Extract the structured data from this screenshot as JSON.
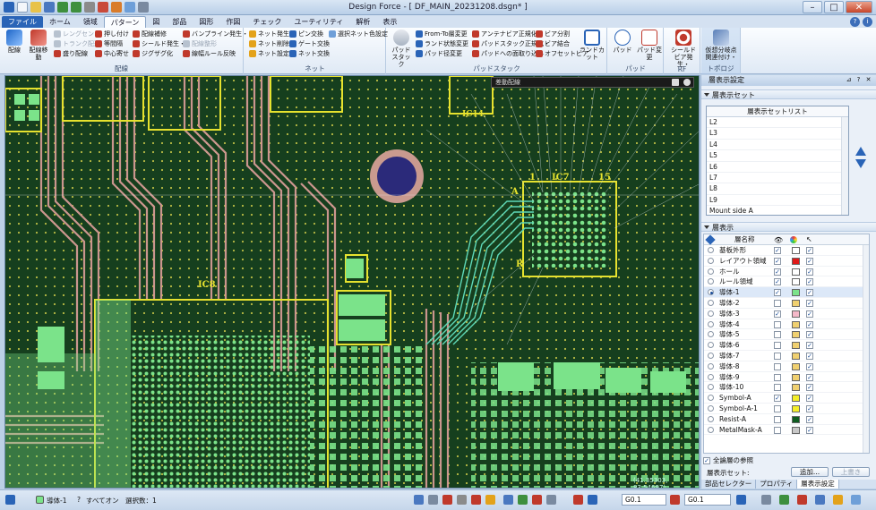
{
  "window": {
    "title": "Design Force - [ DF_MAIN_20231208.dsgn* ]"
  },
  "tabs": [
    {
      "label": "ファイル"
    },
    {
      "label": "ホーム"
    },
    {
      "label": "領域"
    },
    {
      "label": "パターン"
    },
    {
      "label": "図"
    },
    {
      "label": "部品"
    },
    {
      "label": "図形"
    },
    {
      "label": "作図"
    },
    {
      "label": "チェック"
    },
    {
      "label": "ユーティリティ"
    },
    {
      "label": "解析"
    },
    {
      "label": "表示"
    }
  ],
  "ribbon": {
    "wiring": {
      "label": "配線",
      "big": [
        "配線",
        "配線移動"
      ],
      "col1": [
        "レングセン",
        "トランク配形",
        "盛り配線"
      ],
      "col2": [
        "押し付け",
        "等間隔",
        "中心寄せ"
      ],
      "col3": [
        "配線補修",
        "シールド発生・",
        "ジグザグ化"
      ],
      "col4": [
        "バンプライン発生・",
        "配線整形",
        "線幅ルール反映"
      ]
    },
    "net": {
      "label": "ネット",
      "col1": [
        "ネット発生",
        "ネット削除",
        "ネット設定"
      ],
      "col2": [
        "ピン交換",
        "ゲート交換",
        "ネット交換"
      ],
      "col3": [
        "選択ネット色設定"
      ]
    },
    "padstack": {
      "label": "パッドスタック",
      "big": [
        "パッドスタック"
      ],
      "col1": [
        "From-To層変更",
        "ランド状態変更",
        "パッド径変更"
      ],
      "col2": [
        "アンテナビア正規化",
        "パッドスタック正規化・",
        "パッドへの面取り込み"
      ],
      "col3": [
        "ビア分割",
        "ビア結合",
        "オフセットビア"
      ],
      "big2": [
        "ランドカット"
      ]
    },
    "pad": {
      "label": "パッド",
      "big": [
        "パッド",
        "パッド変更"
      ]
    },
    "rf": {
      "label": "RF",
      "big": [
        "シールドビア発生・"
      ]
    },
    "topology": {
      "label": "トポロジ",
      "big": [
        "仮想分岐点関連付け・"
      ]
    }
  },
  "canvas": {
    "float_panel_title": "差動配線",
    "coordinates": "(41.35303, 83.54697)",
    "labels": [
      "IC14",
      "IC7",
      "15",
      "A",
      "1",
      "R",
      "IC8"
    ]
  },
  "right_panel": {
    "title": "層表示設定",
    "layer_sets": {
      "header": "層表示セット",
      "list_header": "層表示セットリスト",
      "items": [
        "L2",
        "L3",
        "L4",
        "L5",
        "L6",
        "L7",
        "L8",
        "L9",
        "Mount side A"
      ]
    },
    "layers": {
      "header": "層表示",
      "column_name": "層名称",
      "rows": [
        {
          "name": "基板外形",
          "active": false,
          "visible": true,
          "select": true,
          "color": "#ffffff"
        },
        {
          "name": "レイアウト領域",
          "active": false,
          "visible": true,
          "select": true,
          "color": "#e01818"
        },
        {
          "name": "ホール",
          "active": false,
          "visible": true,
          "select": true,
          "color": "#ffffff"
        },
        {
          "name": "ルール領域",
          "active": false,
          "visible": true,
          "select": true,
          "color": "#ffffff"
        },
        {
          "name": "導体-1",
          "active": true,
          "visible": true,
          "select": true,
          "color": "#7be38a"
        },
        {
          "name": "導体-2",
          "active": false,
          "visible": false,
          "select": true,
          "color": "#f0d070"
        },
        {
          "name": "導体-3",
          "active": false,
          "visible": true,
          "select": true,
          "color": "#f4b8c8"
        },
        {
          "name": "導体-4",
          "active": false,
          "visible": false,
          "select": true,
          "color": "#f0d070"
        },
        {
          "name": "導体-5",
          "active": false,
          "visible": false,
          "select": true,
          "color": "#f0d070"
        },
        {
          "name": "導体-6",
          "active": false,
          "visible": false,
          "select": true,
          "color": "#f0d070"
        },
        {
          "name": "導体-7",
          "active": false,
          "visible": false,
          "select": true,
          "color": "#f0d070"
        },
        {
          "name": "導体-8",
          "active": false,
          "visible": false,
          "select": true,
          "color": "#f0d070"
        },
        {
          "name": "導体-9",
          "active": false,
          "visible": false,
          "select": true,
          "color": "#f0d070"
        },
        {
          "name": "導体-10",
          "active": false,
          "visible": false,
          "select": true,
          "color": "#f0d070"
        },
        {
          "name": "Symbol-A",
          "active": false,
          "visible": true,
          "select": true,
          "color": "#f4ee2a"
        },
        {
          "name": "Symbol-A-1",
          "active": false,
          "visible": false,
          "select": true,
          "color": "#f4ee2a"
        },
        {
          "name": "Resist-A",
          "active": false,
          "visible": false,
          "select": true,
          "color": "#0f5c1f"
        },
        {
          "name": "MetalMask-A",
          "active": false,
          "visible": false,
          "select": true,
          "color": "#c8c8c8"
        }
      ]
    },
    "reference_label": "全論層の参照",
    "layer_set_label": "層表示セット:",
    "add_button": "追加...",
    "overwrite_button": "上書き",
    "bottom_tabs": [
      "部品セレクター",
      "プロパティ",
      "層表示設定"
    ]
  },
  "status": {
    "layer": "導体-1",
    "filter": "すべてオン",
    "selection": "選択数：1",
    "grid1": "G0.1",
    "grid2": "G0.1"
  }
}
